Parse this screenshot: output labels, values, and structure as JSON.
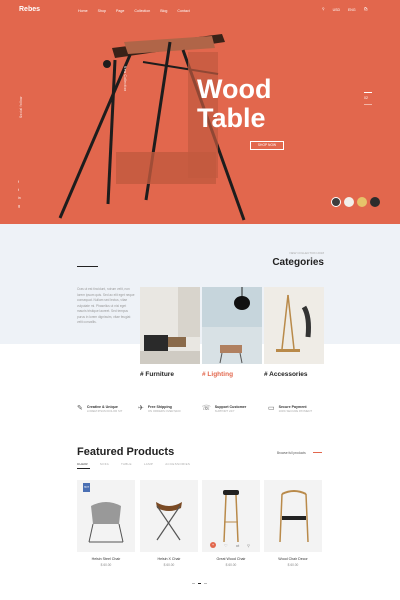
{
  "brand": {
    "logo": "Rebes",
    "accent": "#e2674d"
  },
  "nav": {
    "menu": [
      "Home",
      "Shop",
      "Page",
      "Collection",
      "Blog",
      "Contact"
    ],
    "currency": "USD",
    "language": "ENG",
    "icons": [
      "search-icon",
      "cart-icon"
    ]
  },
  "hero": {
    "side_left": "Social follow",
    "title_line1": "Wood",
    "title_line2": "Table",
    "button": "SHOP NOW",
    "slide_number": "02",
    "vertical_label": "New Collection",
    "social": [
      "f",
      "t",
      "in",
      "g"
    ]
  },
  "categories": {
    "small": "NEW COLLECTION 2018",
    "title": "Categories",
    "text": "Cras ut est tincidunt, rutrum velit, non lorem ipsum quis. Sed ac elit eget neque consequat. Nullam sed lectus, vitae vulputate mi. Phasellus ut nisi eget mauris tristique laoreet. Sed tempus purus in lorem dignissim, vitae feugiat velit convallis.",
    "items": [
      {
        "label": "# Furniture",
        "highlight": false
      },
      {
        "label": "# Lighting",
        "highlight": true
      },
      {
        "label": "# Accessories",
        "highlight": false
      }
    ]
  },
  "features": [
    {
      "title": "Creative & Unique",
      "sub": "LOREM IPSUM DOLOR SIT",
      "icon": "brush-icon"
    },
    {
      "title": "Free Shipping",
      "sub": "ON ORDERS OVER $100",
      "icon": "plane-icon"
    },
    {
      "title": "Support Customer",
      "sub": "SUPPORT 24/7",
      "icon": "support-icon"
    },
    {
      "title": "Secure Payment",
      "sub": "100% SECURE PAYMENT",
      "icon": "card-icon"
    }
  ],
  "featured": {
    "title": "Featured Products",
    "tabs": [
      "CHAIR",
      "SOFA",
      "TABLE",
      "LAMP",
      "ACCESSORIES"
    ],
    "browse": "Browse full products",
    "products": [
      {
        "name": "Helsin Steel Chair",
        "price": "$ 60.00",
        "badge": "HOT"
      },
      {
        "name": "Helsin X Chair",
        "price": "$ 60.00"
      },
      {
        "name": "Great Wood Chair",
        "price": "$ 60.00"
      },
      {
        "name": "Wood Chair Decor",
        "price": "$ 60.00"
      }
    ]
  }
}
